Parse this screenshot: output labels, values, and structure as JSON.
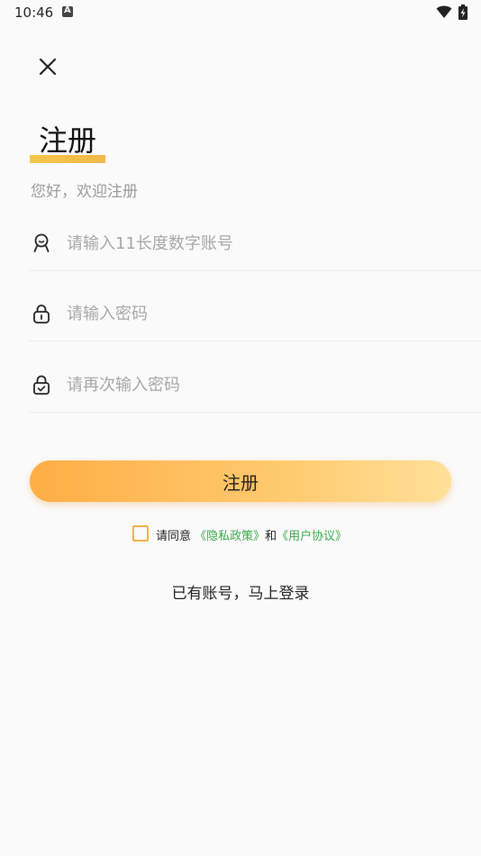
{
  "status_bar": {
    "time": "10:46"
  },
  "page": {
    "title": "注册",
    "subtitle": "您好，欢迎注册"
  },
  "fields": {
    "account": {
      "placeholder": "请输入11长度数字账号",
      "value": ""
    },
    "password": {
      "placeholder": "请输入密码",
      "value": ""
    },
    "confirm_password": {
      "placeholder": "请再次输入密码",
      "value": ""
    }
  },
  "register_button": {
    "label": "注册"
  },
  "agreement": {
    "prefix": "请同意 ",
    "privacy_link": "《隐私政策》",
    "joiner": "和",
    "terms_link": "《用户协议》",
    "checked": false
  },
  "login_link": {
    "label": "已有账号，马上登录"
  },
  "colors": {
    "accent": "#ffad45",
    "link": "#3aa84a",
    "checkbox_border": "#f2b04a",
    "title_underline": "#f5c74a"
  },
  "icons": {
    "close": "close-icon",
    "account": "user-icon",
    "password": "lock-icon",
    "confirm_password": "lock-check-icon"
  }
}
